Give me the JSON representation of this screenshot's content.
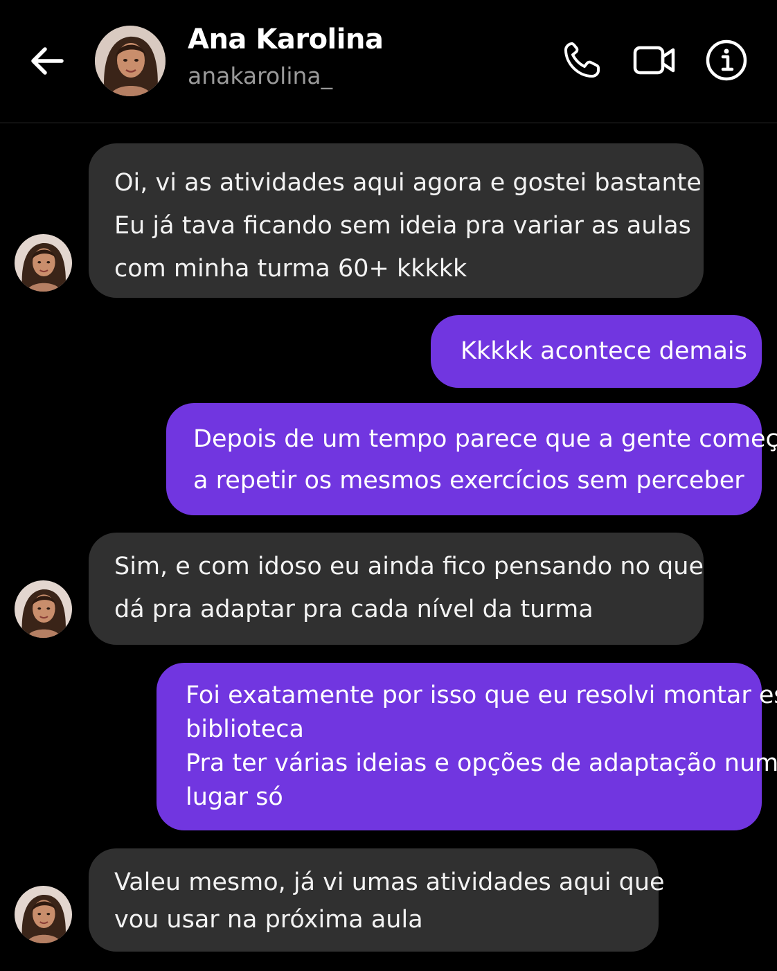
{
  "header": {
    "contact_name": "Ana Karolina",
    "contact_handle": "anakarolina_"
  },
  "icons": {
    "back": "arrow-left-icon",
    "phone": "phone-icon",
    "video": "video-camera-icon",
    "info": "info-icon"
  },
  "colors": {
    "background": "#000000",
    "incoming_bubble": "#303030",
    "outgoing_bubble": "#7136e0",
    "handle_text": "#9a9a9a"
  },
  "messages": [
    {
      "direction": "incoming",
      "lines": [
        "Oi, vi as atividades aqui agora e gostei bastante",
        "Eu já tava ficando sem ideia pra variar as aulas",
        "com minha turma 60+ kkkkk"
      ]
    },
    {
      "direction": "outgoing",
      "lines": [
        "Kkkkk acontece demais"
      ]
    },
    {
      "direction": "outgoing",
      "lines": [
        "Depois de um tempo parece que a gente começa",
        "a repetir os mesmos exercícios sem perceber"
      ]
    },
    {
      "direction": "incoming",
      "lines": [
        "Sim, e com idoso eu ainda fico pensando no que",
        "dá pra adaptar pra cada nível da turma"
      ]
    },
    {
      "direction": "outgoing",
      "lines": [
        "Foi exatamente por isso que eu resolvi montar essa",
        "biblioteca",
        "Pra ter várias ideias e opções de adaptação num",
        "lugar só"
      ]
    },
    {
      "direction": "incoming",
      "lines": [
        "Valeu mesmo, já vi umas atividades aqui que",
        "vou usar na próxima aula"
      ]
    }
  ]
}
